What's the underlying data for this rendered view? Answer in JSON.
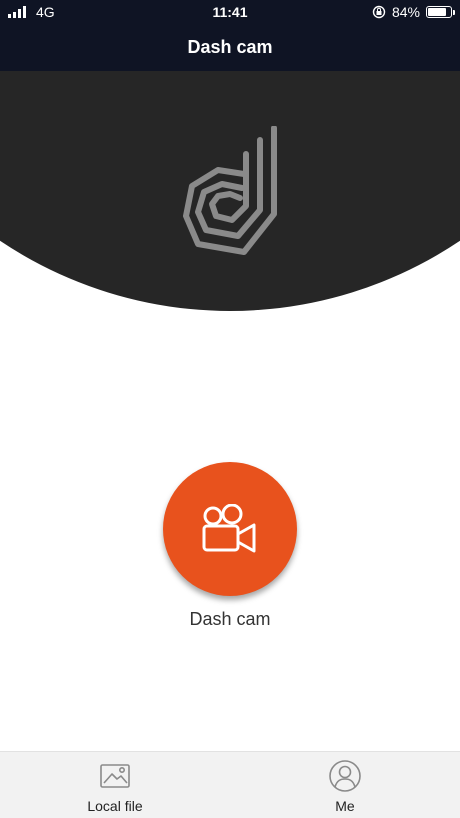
{
  "status_bar": {
    "network": "4G",
    "time": "11:41",
    "battery_percent": "84%",
    "battery_level": 0.84
  },
  "nav": {
    "title": "Dash cam"
  },
  "hero": {
    "logo_icon": "dash-d-logo"
  },
  "main": {
    "device_label": "Dash cam",
    "device_icon": "video-camera-icon",
    "accent_color": "#e8521d"
  },
  "tabs": [
    {
      "label": "Local file",
      "icon": "gallery-icon"
    },
    {
      "label": "Me",
      "icon": "user-icon"
    }
  ]
}
